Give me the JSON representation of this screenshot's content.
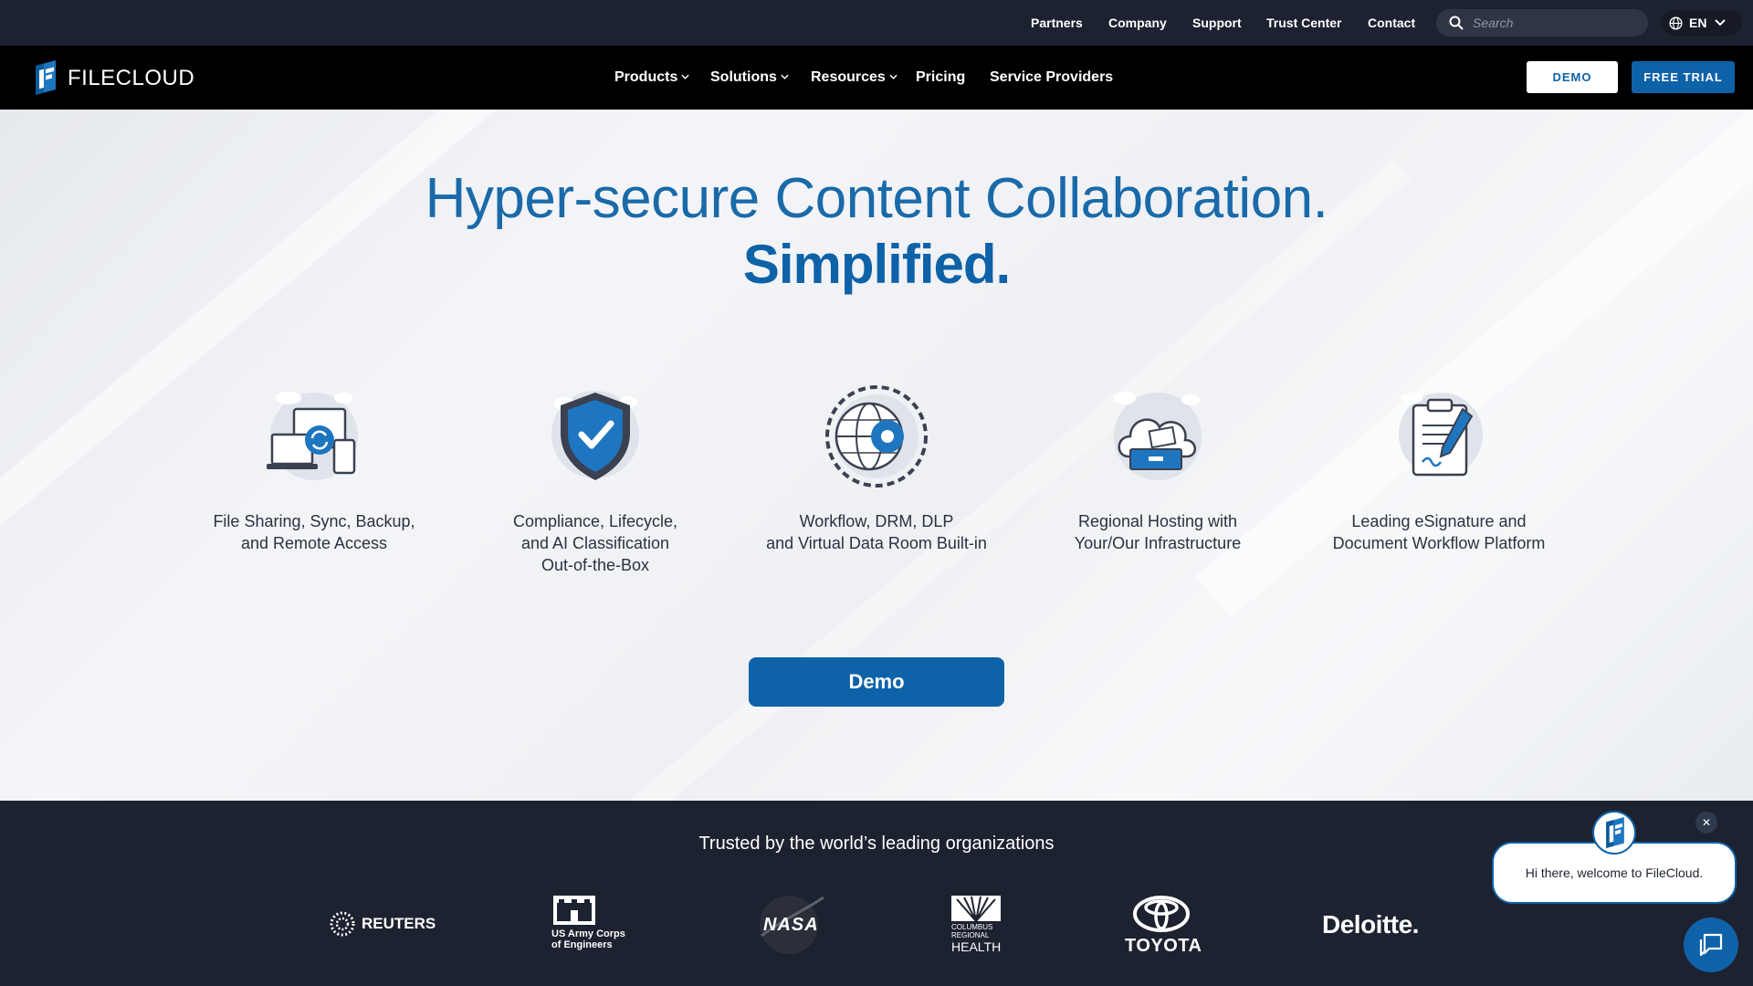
{
  "utility_nav": {
    "links": [
      "Partners",
      "Company",
      "Support",
      "Trust Center",
      "Contact"
    ],
    "search_placeholder": "Search",
    "language": "EN"
  },
  "brand": {
    "name": "FILECLOUD",
    "color": "#0e62a8"
  },
  "main_nav": {
    "items": [
      {
        "label": "Products",
        "has_dropdown": true
      },
      {
        "label": "Solutions",
        "has_dropdown": true
      },
      {
        "label": "Resources",
        "has_dropdown": true
      },
      {
        "label": "Pricing",
        "has_dropdown": false
      },
      {
        "label": "Service Providers",
        "has_dropdown": false
      }
    ],
    "demo_button": "DEMO",
    "trial_button": "FREE TRIAL"
  },
  "hero": {
    "title": "Hyper-secure Content Collaboration.",
    "subtitle": "Simplified.",
    "features": [
      {
        "icon": "devices-sync-icon",
        "label": "File Sharing, Sync, Backup,\nand Remote Access"
      },
      {
        "icon": "shield-check-icon",
        "label": "Compliance, Lifecycle,\nand AI Classification\nOut-of-the-Box"
      },
      {
        "icon": "globe-gear-icon",
        "label": "Workflow, DRM, DLP\nand Virtual Data Room Built-in"
      },
      {
        "icon": "cloud-storage-icon",
        "label": "Regional Hosting with\nYour/Our Infrastructure"
      },
      {
        "icon": "clipboard-signature-icon",
        "label": "Leading eSignature and\nDocument Workflow Platform"
      }
    ],
    "demo_button": "Demo"
  },
  "trust": {
    "heading": "Trusted by the world’s leading organizations",
    "logos": [
      {
        "name": "reuters-logo",
        "text": "REUTERS"
      },
      {
        "name": "us-army-corps-logo",
        "lines": [
          "US Army Corps",
          "of Engineers"
        ]
      },
      {
        "name": "nasa-logo",
        "text": "NASA"
      },
      {
        "name": "columbus-regional-health-logo",
        "lines": [
          "COLUMBUS",
          "REGIONAL",
          "HEALTH"
        ]
      },
      {
        "name": "toyota-logo",
        "text": "TOYOTA"
      },
      {
        "name": "deloitte-logo",
        "text": "Deloitte."
      }
    ]
  },
  "chat": {
    "message": "Hi there, welcome to FileCloud.",
    "close_symbol": "✕"
  }
}
